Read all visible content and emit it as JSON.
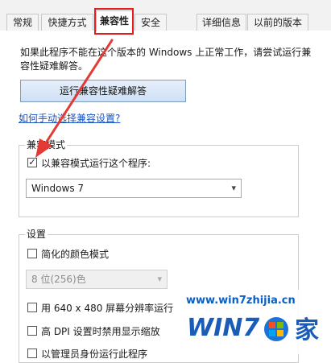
{
  "tabs": [
    {
      "label": "常规"
    },
    {
      "label": "快捷方式"
    },
    {
      "label": "兼容性"
    },
    {
      "label": "安全"
    },
    {
      "label": "详细信息"
    },
    {
      "label": "以前的版本"
    }
  ],
  "intro_text": "如果此程序不能在这个版本的 Windows 上正常工作，请尝试运行兼容性疑难解答。",
  "troubleshooter_button": "运行兼容性疑难解答",
  "manual_link": "如何手动选择兼容设置?",
  "compat_mode": {
    "label": "兼容模式",
    "checkbox_label": "以兼容模式运行这个程序:",
    "checked": true,
    "selected_os": "Windows 7"
  },
  "settings": {
    "label": "设置",
    "reduced_color": "简化的颜色模式",
    "color_select": "8 位(256)色",
    "res_640": "用 640 x 480 屏幕分辨率运行",
    "high_dpi": "高 DPI 设置时禁用显示缩放",
    "run_admin": "以管理员身份运行此程序"
  },
  "watermark": {
    "url": "www.win7zhijia.cn",
    "brand": "WIN7",
    "suffix": "家"
  },
  "colors": {
    "highlight": "#e11d1d",
    "arrow": "#e53935",
    "link": "#1a54c4"
  }
}
